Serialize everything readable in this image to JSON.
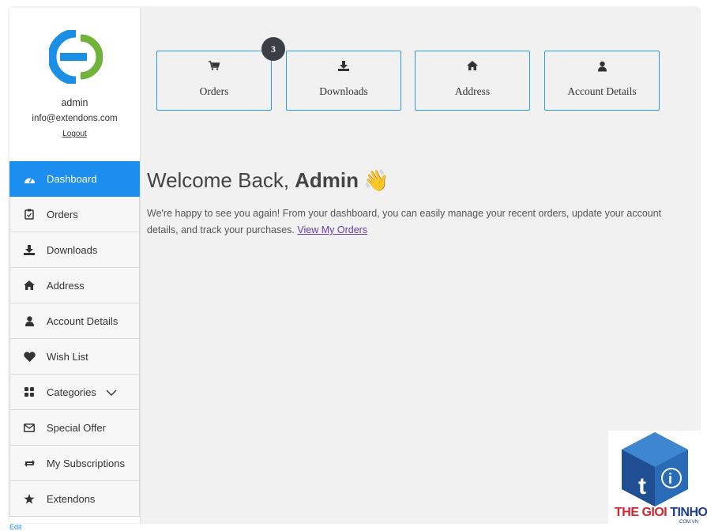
{
  "profile": {
    "name": "admin",
    "email": "info@extendons.com",
    "logout_label": "Logout"
  },
  "sidebar": {
    "items": [
      {
        "label": "Dashboard",
        "icon": "dashboard-icon",
        "active": true
      },
      {
        "label": "Orders",
        "icon": "clipboard-icon"
      },
      {
        "label": "Downloads",
        "icon": "download-icon"
      },
      {
        "label": "Address",
        "icon": "home-icon"
      },
      {
        "label": "Account Details",
        "icon": "user-icon"
      },
      {
        "label": "Wish List",
        "icon": "heart-icon"
      },
      {
        "label": "Categories",
        "icon": "grid-icon"
      },
      {
        "label": "Special Offer",
        "icon": "envelope-icon"
      },
      {
        "label": "My Subscriptions",
        "icon": "retweet-icon"
      },
      {
        "label": "Extendons",
        "icon": "star-icon"
      }
    ]
  },
  "tiles": [
    {
      "label": "Orders",
      "icon": "cart-icon",
      "badge": "3"
    },
    {
      "label": "Downloads",
      "icon": "download-icon"
    },
    {
      "label": "Address",
      "icon": "home-icon"
    },
    {
      "label": "Account Details",
      "icon": "user-icon"
    }
  ],
  "welcome": {
    "greeting": "Welcome Back,",
    "name": "Admin",
    "emoji": "👋",
    "intro": "We're happy to see you again! From your dashboard, you can easily manage your recent orders, update your account details, and track your purchases.",
    "link_label": "View My Orders"
  },
  "footer": {
    "edit_label": "Edit"
  },
  "watermark": {
    "brand_red": "THE GIOI",
    "brand_blue": "TINHOC",
    "domain": ".COM.VN"
  },
  "colors": {
    "accent": "#1c8ef0",
    "tile_border": "#2f9be0",
    "link": "#6a3ea1"
  }
}
